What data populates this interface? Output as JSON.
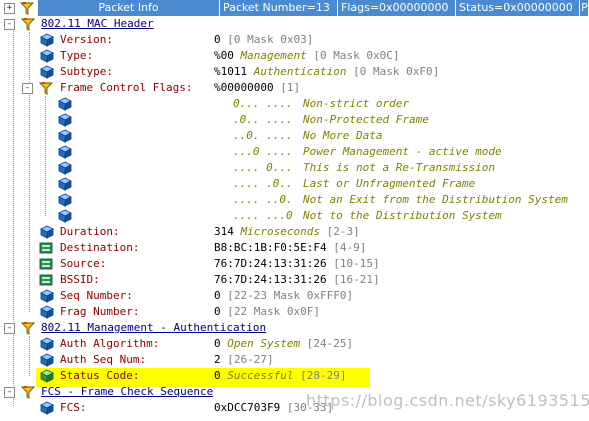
{
  "header": {
    "expand": "+",
    "columns": [
      "Packet Info",
      "Packet Number=13",
      "Flags=0x00000000",
      "Status=0x00000000",
      "P"
    ]
  },
  "mac": {
    "expand": "-",
    "title": "802.11 MAC Header",
    "version": {
      "label": "Version:",
      "value": "0",
      "range": "[0 Mask 0x03]"
    },
    "type": {
      "label": "Type:",
      "value": "%00",
      "desc": "Management",
      "range": "[0 Mask 0x0C]"
    },
    "subtype": {
      "label": "Subtype:",
      "value": "%1011",
      "desc": "Authentication",
      "range": "[0 Mask 0xF0]"
    },
    "fcf": {
      "expand": "-",
      "label": "Frame Control Flags:",
      "value": "%00000000",
      "range": "[1]"
    },
    "flags": [
      {
        "bits": "0... ....",
        "desc": "Non-strict order"
      },
      {
        "bits": ".0.. ....",
        "desc": "Non-Protected Frame"
      },
      {
        "bits": "..0. ....",
        "desc": "No More Data"
      },
      {
        "bits": "...0 ....",
        "desc": "Power Management - active mode"
      },
      {
        "bits": ".... 0...",
        "desc": "This is not a Re-Transmission"
      },
      {
        "bits": ".... .0..",
        "desc": "Last or Unfragmented Frame"
      },
      {
        "bits": ".... ..0.",
        "desc": "Not an Exit from the Distribution System"
      },
      {
        "bits": ".... ...0",
        "desc": "Not to the Distribution System"
      }
    ],
    "duration": {
      "label": "Duration:",
      "value": "314",
      "desc": "Microseconds",
      "range": "[2-3]"
    },
    "destination": {
      "label": "Destination:",
      "value": "B8:BC:1B:F0:5E:F4",
      "range": "[4-9]"
    },
    "source": {
      "label": "Source:",
      "value": "76:7D:24:13:31:26",
      "range": "[10-15]"
    },
    "bssid": {
      "label": "BSSID:",
      "value": "76:7D:24:13:31:26",
      "range": "[16-21]"
    },
    "seq": {
      "label": "Seq Number:",
      "value": "0",
      "range": "[22-23 Mask 0xFFF0]"
    },
    "frag": {
      "label": "Frag Number:",
      "value": "0",
      "range": "[22 Mask 0x0F]"
    }
  },
  "mgmt": {
    "expand": "-",
    "title": "802.11 Management - Authentication",
    "auth_alg": {
      "label": "Auth Algorithm:",
      "value": "0",
      "desc": "Open System",
      "range": "[24-25]"
    },
    "auth_seq": {
      "label": "Auth Seq Num:",
      "value": "2",
      "range": "[26-27]"
    },
    "status": {
      "label": "Status Code:",
      "value": "0",
      "desc": "Successful",
      "range": "[28-29]"
    }
  },
  "fcs": {
    "expand": "-",
    "title": "FCS - Frame Check Sequence",
    "fcs": {
      "label": "FCS:",
      "value": "0xDCC703F9",
      "range": "[30-33]"
    }
  },
  "watermark": "https://blog.csdn.net/sky619351517",
  "colors": {
    "header_bg": "#4a8ad0",
    "title": "#000080",
    "field": "#8b0000",
    "desc": "#808000",
    "range": "#808080",
    "highlight": "#ffff00",
    "cube_blue": "#1e6fd0",
    "cube_green": "#2e9a3c"
  }
}
